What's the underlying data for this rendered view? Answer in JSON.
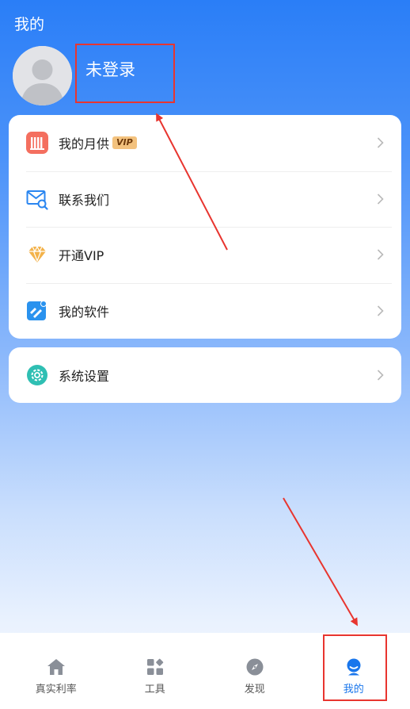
{
  "header": {
    "title": "我的"
  },
  "profile": {
    "username": "未登录"
  },
  "menu": {
    "items": [
      {
        "label": "我的月供",
        "tag": "VIP",
        "icon": "calendar-bars-icon"
      },
      {
        "label": "联系我们",
        "icon": "mail-search-icon"
      },
      {
        "label": "开通VIP",
        "icon": "diamond-icon"
      },
      {
        "label": "我的软件",
        "icon": "software-edit-icon"
      }
    ]
  },
  "settings": {
    "label": "系统设置",
    "icon": "gear-icon"
  },
  "tabbar": {
    "items": [
      {
        "label": "真实利率",
        "icon": "home-icon"
      },
      {
        "label": "工具",
        "icon": "grid-icon"
      },
      {
        "label": "发现",
        "icon": "compass-icon"
      },
      {
        "label": "我的",
        "icon": "user-icon",
        "active": true
      }
    ]
  },
  "colors": {
    "primary": "#1976ec",
    "annotation": "#e8352f",
    "vip_tag": "#f3c27e"
  }
}
